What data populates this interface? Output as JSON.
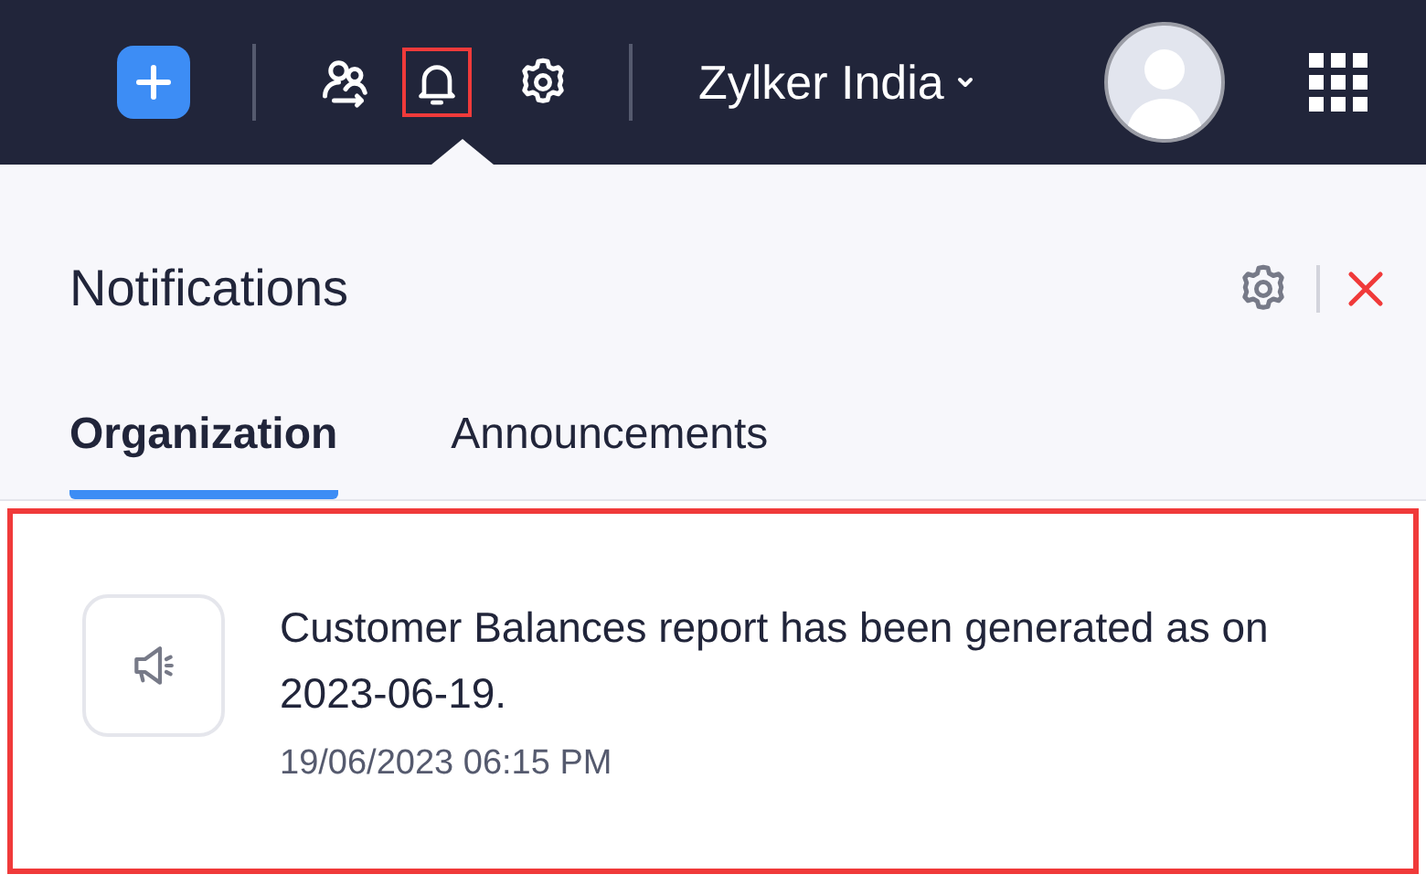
{
  "topbar": {
    "org_name": "Zylker India",
    "bell_highlighted": true
  },
  "panel": {
    "title": "Notifications",
    "tabs": [
      {
        "label": "Organization",
        "selected": true
      },
      {
        "label": "Announcements",
        "selected": false
      }
    ],
    "notifications": [
      {
        "message": "Customer Balances report has been generated as on 2023-06-19.",
        "time": "19/06/2023 06:15 PM",
        "highlighted": true
      }
    ]
  }
}
